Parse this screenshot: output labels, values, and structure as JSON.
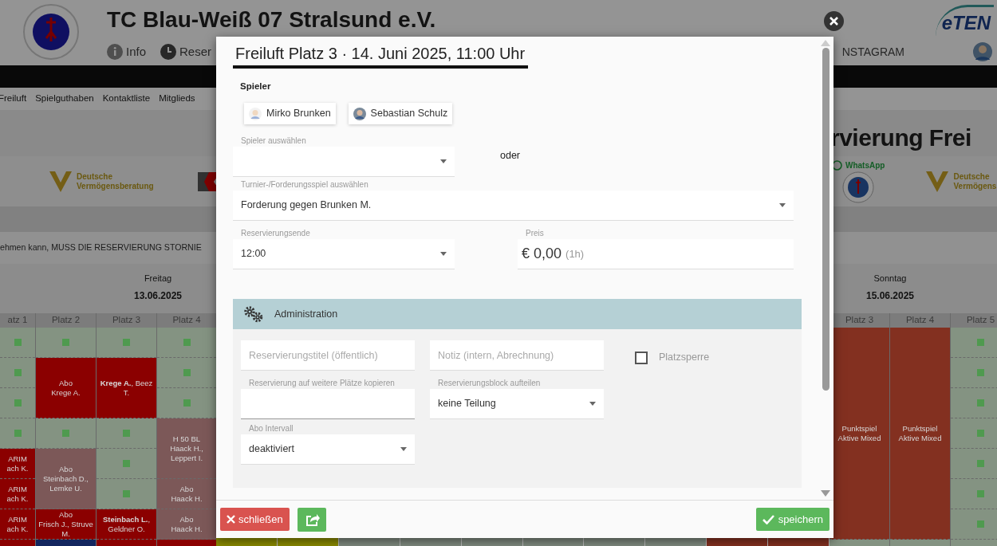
{
  "header": {
    "title": "TC Blau-Weiß 07 Stralsund e.V.",
    "links": [
      {
        "label": "Info"
      },
      {
        "label": "Reser"
      }
    ],
    "right_link": "NSTAGRAM",
    "brand": "eTEN"
  },
  "nav": [
    "Freiluft",
    "Spielguthaben",
    "Kontaktliste",
    "Mitglieds"
  ],
  "page_heading": "rvierung Frei",
  "sponsors_left": [
    {
      "kind": "dvag",
      "text": "Deutsche\nVermögensberatung"
    },
    {
      "kind": "k-logo"
    }
  ],
  "sponsors_right": [
    {
      "kind": "whatsapp",
      "text": "WhatsApp"
    },
    {
      "kind": "dvag",
      "text": "Deutsche\nVermögens"
    }
  ],
  "notice": "ehmen kann, MUSS DIE RESERVIERUNG STORNIE",
  "days": [
    {
      "weekday": "Freitag",
      "date": "13.06.2025"
    },
    {
      "weekday": "Sonntag",
      "date": "15.06.2025"
    }
  ],
  "grid_left": [
    {
      "label": "atz 1",
      "slots": [
        {
          "kind": "free"
        },
        {
          "kind": "free"
        },
        {
          "kind": "free"
        },
        {
          "kind": "free"
        },
        {
          "kind": "booking",
          "color": "#8b0000",
          "text": "ARIM\nach K."
        },
        {
          "kind": "booking",
          "color": "#8b0000",
          "text": "ARIM\nach K."
        },
        {
          "kind": "booking",
          "color": "#8b0000",
          "text": "ARIM\nach K."
        },
        {
          "kind": "booking",
          "color": "#8b0000"
        }
      ]
    },
    {
      "label": "Platz 2",
      "slots": [
        {
          "kind": "free"
        },
        {
          "kind": "booking",
          "color": "#8b0000",
          "text": "Abo\nKrege A."
        },
        {
          "kind": "continued"
        },
        {
          "kind": "free"
        },
        {
          "kind": "booking",
          "color": "#7c5858",
          "text": "Abo\nSteinbach D.,\nLemke U."
        },
        {
          "kind": "continued"
        },
        {
          "kind": "booking",
          "color": "#8b0000",
          "text": "Abo\nFrisch J., Struve\nM."
        },
        {
          "kind": "booking",
          "color": "#13265f"
        }
      ]
    },
    {
      "label": "Platz 3",
      "slots": [
        {
          "kind": "free"
        },
        {
          "kind": "booking",
          "color": "#8b0000",
          "text": "**Krege A.**, Beez T."
        },
        {
          "kind": "continued"
        },
        {
          "kind": "free"
        },
        {
          "kind": "free"
        },
        {
          "kind": "free"
        },
        {
          "kind": "booking",
          "color": "#8b0000",
          "text": "**Steinbach L.**,\nGeldner O."
        },
        {
          "kind": "booking",
          "color": "#8b0000"
        }
      ]
    },
    {
      "label": "Platz 4",
      "slots": [
        {
          "kind": "free"
        },
        {
          "kind": "free"
        },
        {
          "kind": "free"
        },
        {
          "kind": "booking",
          "color": "#7c5858",
          "text": "H 50 BL\nHaack H.,\nLeppert I."
        },
        {
          "kind": "continued"
        },
        {
          "kind": "booking",
          "color": "#7c5858",
          "text": "Abo\nHaack H."
        },
        {
          "kind": "booking",
          "color": "#7c5858",
          "text": "Abo\nHaack H."
        },
        {
          "kind": "booking",
          "color": "#8b0000"
        }
      ]
    }
  ],
  "grid_middle_peek": [
    {
      "color": "#8a8a00"
    },
    {
      "color": "#8a8a00"
    },
    {
      "color": "#7f8a7f"
    },
    {
      "color": "#7f8a7f"
    },
    {
      "color": "#7f8a7f"
    },
    {
      "color": "#7f8a7f"
    },
    {
      "color": "#7f8a7f"
    },
    {
      "color": "#7f8a7f"
    },
    {
      "color": "#833020"
    },
    {
      "color": "#833020"
    }
  ],
  "grid_right": [
    {
      "label": "Platz 3",
      "slots": [
        {
          "kind": "booking",
          "color": "#833020",
          "text": "Punktspiel\nAktive Mixed"
        },
        {
          "kind": "continued"
        },
        {
          "kind": "continued"
        },
        {
          "kind": "continued"
        },
        {
          "kind": "continued"
        },
        {
          "kind": "continued"
        },
        {
          "kind": "continued"
        },
        {
          "kind": "free-cut"
        }
      ]
    },
    {
      "label": "Platz 4",
      "slots": [
        {
          "kind": "booking",
          "color": "#833020",
          "text": "Punktspiel\nAktive Mixed"
        },
        {
          "kind": "continued"
        },
        {
          "kind": "continued"
        },
        {
          "kind": "continued"
        },
        {
          "kind": "continued"
        },
        {
          "kind": "continued"
        },
        {
          "kind": "continued"
        },
        {
          "kind": "free-cut"
        }
      ]
    },
    {
      "label": "Platz 5",
      "slots": [
        {
          "kind": "free"
        },
        {
          "kind": "free"
        },
        {
          "kind": "free"
        },
        {
          "kind": "free"
        },
        {
          "kind": "free"
        },
        {
          "kind": "free"
        },
        {
          "kind": "free"
        },
        {
          "kind": "free-cut"
        }
      ]
    }
  ],
  "modal": {
    "title": "Freiluft Platz 3 · 14. Juni 2025, 11:00 Uhr",
    "players_label": "Spieler",
    "players": [
      {
        "name": "Mirko Brunken",
        "kind": "cartoon"
      },
      {
        "name": "Sebastian Schulz",
        "kind": "photo"
      }
    ],
    "player_select": {
      "label": "Spieler auswählen"
    },
    "or_text": "oder",
    "match_select": {
      "label": "Turnier-/Forderungsspiel auswählen",
      "value": "Forderung gegen Brunken M."
    },
    "end_select": {
      "label": "Reservierungsende",
      "value": "12:00"
    },
    "price": {
      "label": "Preis",
      "value": "€ 0,00",
      "note": "(1h)"
    },
    "admin": {
      "title": "Administration",
      "title_input": {
        "placeholder": "Reservierungstitel (öffentlich)"
      },
      "note_input": {
        "placeholder": "Notiz (intern, Abrechnung)"
      },
      "court_block": {
        "label": "Platzsperre",
        "checked": false
      },
      "copy_field": {
        "label": "Reservierung auf weitere Plätze kopieren"
      },
      "split_select": {
        "label": "Reservierungsblock aufteilen",
        "value": "keine Teilung"
      },
      "abo_select": {
        "label": "Abo Intervall",
        "value": "deaktiviert"
      }
    },
    "buttons": [
      {
        "kind": "close",
        "label": "schließen"
      },
      {
        "kind": "share"
      },
      {
        "kind": "save",
        "label": "speichern"
      }
    ]
  }
}
